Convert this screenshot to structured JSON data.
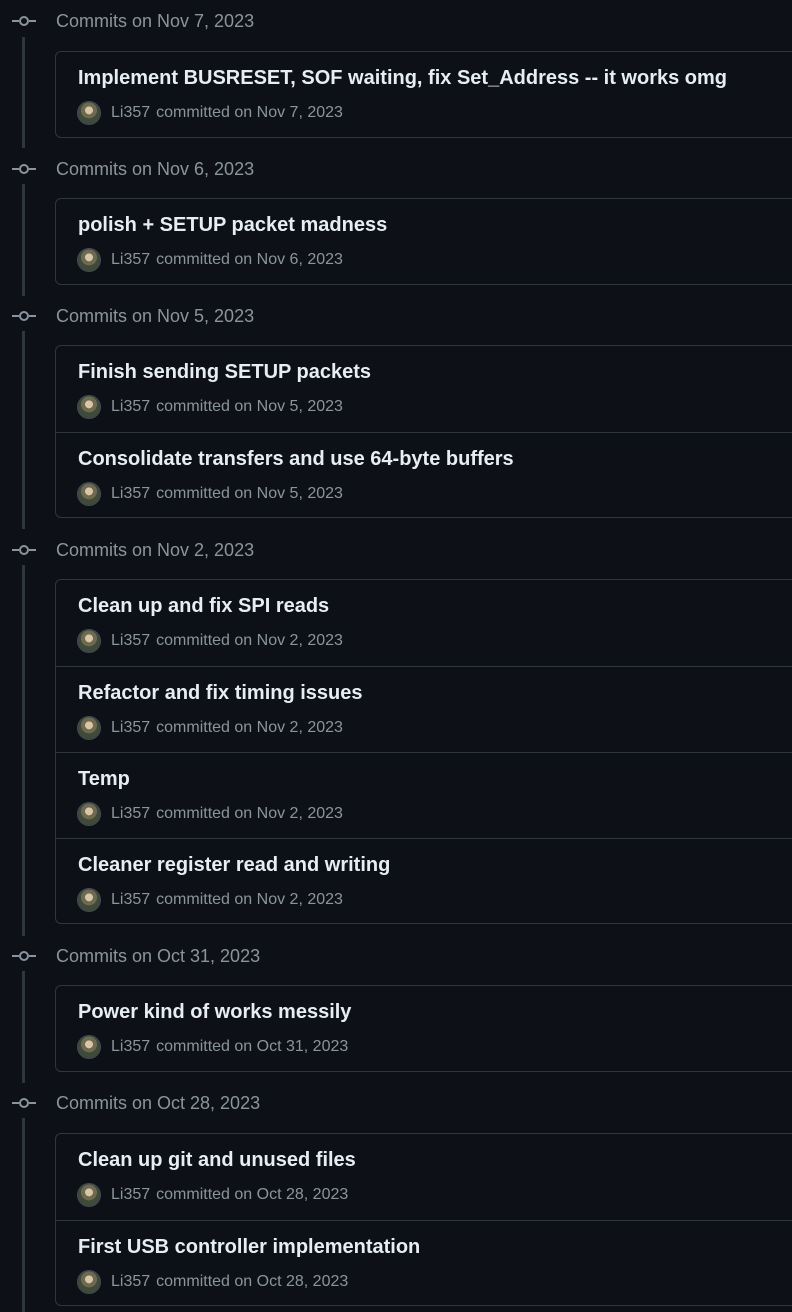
{
  "groups": [
    {
      "title": "Commits on Nov 7, 2023",
      "commits": [
        {
          "message": "Implement BUSRESET, SOF waiting, fix Set_Address -- it works omg",
          "author": "Li357",
          "meta": "committed on Nov 7, 2023"
        }
      ]
    },
    {
      "title": "Commits on Nov 6, 2023",
      "commits": [
        {
          "message": "polish + SETUP packet madness",
          "author": "Li357",
          "meta": "committed on Nov 6, 2023"
        }
      ]
    },
    {
      "title": "Commits on Nov 5, 2023",
      "commits": [
        {
          "message": "Finish sending SETUP packets",
          "author": "Li357",
          "meta": "committed on Nov 5, 2023"
        },
        {
          "message": "Consolidate transfers and use 64-byte buffers",
          "author": "Li357",
          "meta": "committed on Nov 5, 2023"
        }
      ]
    },
    {
      "title": "Commits on Nov 2, 2023",
      "commits": [
        {
          "message": "Clean up and fix SPI reads",
          "author": "Li357",
          "meta": "committed on Nov 2, 2023"
        },
        {
          "message": "Refactor and fix timing issues",
          "author": "Li357",
          "meta": "committed on Nov 2, 2023"
        },
        {
          "message": "Temp",
          "author": "Li357",
          "meta": "committed on Nov 2, 2023"
        },
        {
          "message": "Cleaner register read and writing",
          "author": "Li357",
          "meta": "committed on Nov 2, 2023"
        }
      ]
    },
    {
      "title": "Commits on Oct 31, 2023",
      "commits": [
        {
          "message": "Power kind of works messily",
          "author": "Li357",
          "meta": "committed on Oct 31, 2023"
        }
      ]
    },
    {
      "title": "Commits on Oct 28, 2023",
      "commits": [
        {
          "message": "Clean up git and unused files",
          "author": "Li357",
          "meta": "committed on Oct 28, 2023"
        },
        {
          "message": "First USB controller implementation",
          "author": "Li357",
          "meta": "committed on Oct 28, 2023"
        }
      ]
    }
  ],
  "colors": {
    "background": "#0d1117",
    "border": "#30363d",
    "text_primary": "#e6edf3",
    "text_muted": "#8b949e"
  },
  "icons": {
    "group_icon": "git-commit-icon",
    "author_avatar": "avatar"
  }
}
